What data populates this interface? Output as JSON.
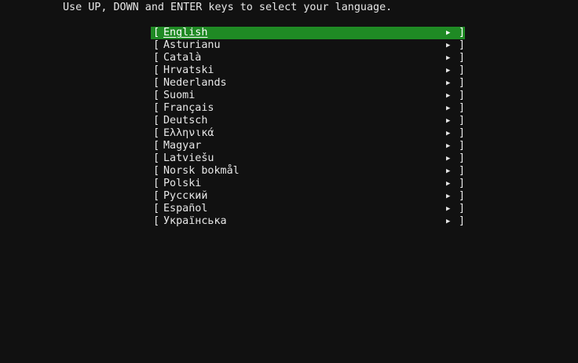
{
  "header": {
    "instruction": "Use UP, DOWN and ENTER keys to select your language."
  },
  "menu": {
    "bracket_open": "[",
    "bracket_close": "]",
    "arrow": "▶",
    "selected_index": 0,
    "selected_color": "#1f8a24",
    "items": [
      {
        "label": "English"
      },
      {
        "label": "Asturianu"
      },
      {
        "label": "Català"
      },
      {
        "label": "Hrvatski"
      },
      {
        "label": "Nederlands"
      },
      {
        "label": "Suomi"
      },
      {
        "label": "Français"
      },
      {
        "label": "Deutsch"
      },
      {
        "label": "Ελληνικά"
      },
      {
        "label": "Magyar"
      },
      {
        "label": "Latviešu"
      },
      {
        "label": "Norsk bokmål"
      },
      {
        "label": "Polski"
      },
      {
        "label": "Русский"
      },
      {
        "label": "Español"
      },
      {
        "label": "Українська"
      }
    ]
  }
}
